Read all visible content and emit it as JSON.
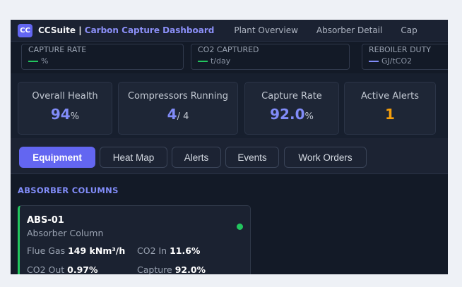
{
  "nav": {
    "logo": "CC",
    "brand": "CCSuite |",
    "brand_sub": "Carbon Capture Dashboard",
    "links": [
      "Plant Overview",
      "Absorber Detail",
      "Cap"
    ]
  },
  "kpi_strip": [
    {
      "label": "CAPTURE RATE",
      "value": "%",
      "color": "#22c55e"
    },
    {
      "label": "CO2 CAPTURED",
      "value": "t/day",
      "color": "#22c55e"
    },
    {
      "label": "REBOILER DUTY",
      "value": "GJ/tCO2",
      "color": "#818cf8"
    }
  ],
  "stats": [
    {
      "label": "Overall Health",
      "value": "94",
      "unit": "%",
      "color": "#818cf8"
    },
    {
      "label": "Compressors Running",
      "value": "4",
      "unit": "/ 4",
      "color": "#818cf8"
    },
    {
      "label": "Capture Rate",
      "value": "92.0",
      "unit": "%",
      "color": "#818cf8"
    },
    {
      "label": "Active Alerts",
      "value": "1",
      "unit": "",
      "color": "#f59e0b"
    }
  ],
  "tabs": [
    "Equipment",
    "Heat Map",
    "Alerts",
    "Events",
    "Work Orders"
  ],
  "section": {
    "title": "ABSORBER COLUMNS",
    "card": {
      "id": "ABS-01",
      "type": "Absorber Column",
      "flue_label": "Flue Gas",
      "flue_value": "149 kNm³/h",
      "co2in_label": "CO2 In",
      "co2in_value": "11.6%",
      "co2out_label": "CO2 Out",
      "co2out_value": "0.97%",
      "capture_label": "Capture",
      "capture_value": "92.0%"
    }
  }
}
